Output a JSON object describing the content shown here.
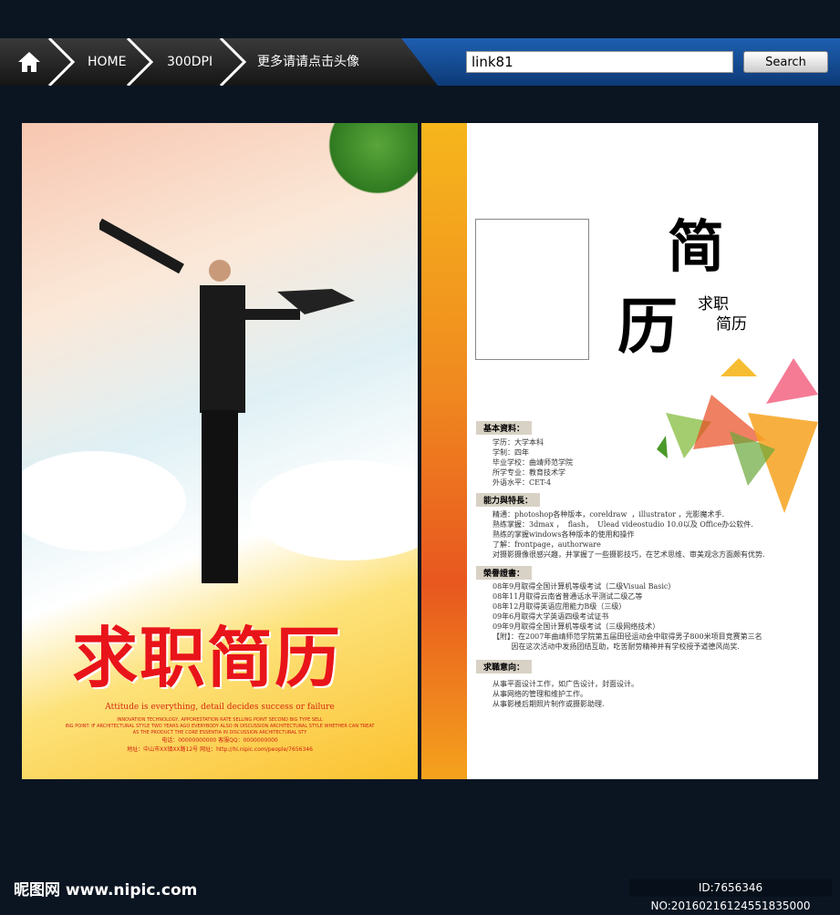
{
  "nav": {
    "crumbs": [
      "HOME",
      "300DPI",
      "更多请请点击头像"
    ],
    "search_value": "link81",
    "search_label": "Search"
  },
  "poster": {
    "title": "求职简历",
    "motto": "Attitude is everything, detail decides success or failure",
    "small_lines": [
      "INNOVATION TECHNOLOGY, APPORESTATION RATE SELLING POINT SECOND BIG TYPE SELL",
      "ING POINT: IF ARCHITECTURAL STYLE TWO YEARS AGO EVERYBODY ALSO IN DISCUSSION ARCHITECTURAL STYLE WHETHER CAN TREAT",
      "AS THE PRODUCT THE CORE ESSENTIA IN DISCUSSION ARCHITECTURAL STY"
    ],
    "phone": "电话：00000000000   客服QQ：0000000000",
    "address": "地址：中山市XX镇XX路12号   网址：http://hi.nipic.com/people/7656346"
  },
  "resume": {
    "title_1": "简",
    "title_2": "历",
    "subtitle": [
      "求职",
      "简历"
    ],
    "sections": [
      {
        "heading": "基本資料：",
        "lines": [
          "学历：大学本科",
          "学制：四年",
          "毕业学校：曲靖师范学院",
          "所学专业：教育技术学",
          "外语水平：CET-4"
        ]
      },
      {
        "heading": "能力與特長：",
        "lines": [
          "精通：photoshop各种版本，coreldraw  ，illustrator ，光影魔术手.",
          "熟练掌握：3dmax ，  flash，  Ulead videostudio 10.0以及 Office办公软件.",
          "熟练的掌握windows各种版本的使用和操作",
          "了解：frontpage，authorware",
          "对摄影摄像很感兴趣，并掌握了一些摄影技巧，在艺术思维、审美观念方面颇有优势."
        ]
      },
      {
        "heading": "榮譽證書：",
        "lines": [
          "08年9月取得全国计算机等级考试（二级Visual Basic）",
          "08年11月取得云南省普通话水平测试二级乙等",
          "08年12月取得英语应用能力B级（三级）",
          "09年6月取得大学英语四级考试证书",
          "09年9月取得全国计算机等级考试（三级网络技术）",
          "【附】：在2007年曲靖师范学院第五届田径运动会中取得男子800米项目竞赛第三名",
          "        因在这次活动中发扬团结互助，吃苦耐劳精神并有学校授予道德风尚奖."
        ]
      },
      {
        "heading": "求職意向：",
        "lines": [
          "从事平面设计工作，如广告设计，封面设计。",
          "从事网络的管理和维护工作。",
          "从事影楼后期照片制作或摄影助理."
        ]
      }
    ]
  },
  "footer": {
    "watermark": "昵图网 www.nipic.com",
    "id_text": "ID:7656346 NO:20160216124551835000"
  }
}
